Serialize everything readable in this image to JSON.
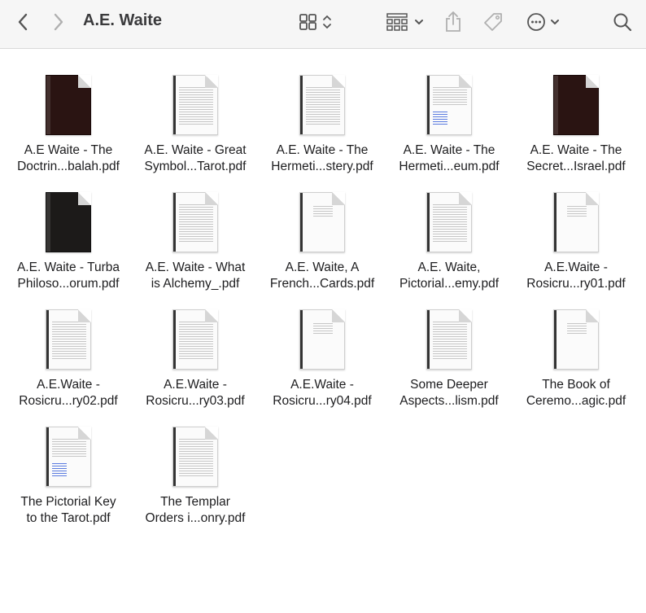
{
  "window": {
    "title": "A.E. Waite"
  },
  "toolbar": {
    "back_icon": "chevron-left-icon",
    "forward_icon": "chevron-right-icon",
    "view_icon": "grid-view-icon",
    "group_icon": "group-by-icon",
    "share_icon": "share-icon",
    "tag_icon": "tag-icon",
    "more_icon": "more-actions-icon",
    "search_icon": "search-icon"
  },
  "files": [
    {
      "line1": "A.E Waite - The",
      "line2": "Doctrin...balah.pdf",
      "style": "dark"
    },
    {
      "line1": "A.E. Waite - Great",
      "line2": "Symbol...Tarot.pdf",
      "style": "text"
    },
    {
      "line1": "A.E. Waite - The",
      "line2": "Hermeti...stery.pdf",
      "style": "text"
    },
    {
      "line1": "A.E. Waite - The",
      "line2": "Hermeti...eum.pdf",
      "style": "links"
    },
    {
      "line1": "A.E. Waite - The",
      "line2": "Secret...Israel.pdf",
      "style": "dark"
    },
    {
      "line1": "A.E. Waite - Turba",
      "line2": "Philoso...orum.pdf",
      "style": "black"
    },
    {
      "line1": "A.E. Waite - What",
      "line2": "is Alchemy_.pdf",
      "style": "text"
    },
    {
      "line1": "A.E. Waite, A",
      "line2": "French...Cards.pdf",
      "style": "title"
    },
    {
      "line1": "A.E. Waite,",
      "line2": "Pictorial...emy.pdf",
      "style": "text"
    },
    {
      "line1": "A.E.Waite -",
      "line2": "Rosicru...ry01.pdf",
      "style": "title"
    },
    {
      "line1": "A.E.Waite -",
      "line2": "Rosicru...ry02.pdf",
      "style": "text"
    },
    {
      "line1": "A.E.Waite -",
      "line2": "Rosicru...ry03.pdf",
      "style": "text"
    },
    {
      "line1": "A.E.Waite -",
      "line2": "Rosicru...ry04.pdf",
      "style": "title"
    },
    {
      "line1": "Some Deeper",
      "line2": "Aspects...lism.pdf",
      "style": "text"
    },
    {
      "line1": "The Book of",
      "line2": "Ceremo...agic.pdf",
      "style": "title"
    },
    {
      "line1": "The Pictorial Key",
      "line2": "to the Tarot.pdf",
      "style": "links"
    },
    {
      "line1": "The Templar",
      "line2": "Orders i...onry.pdf",
      "style": "text"
    }
  ]
}
